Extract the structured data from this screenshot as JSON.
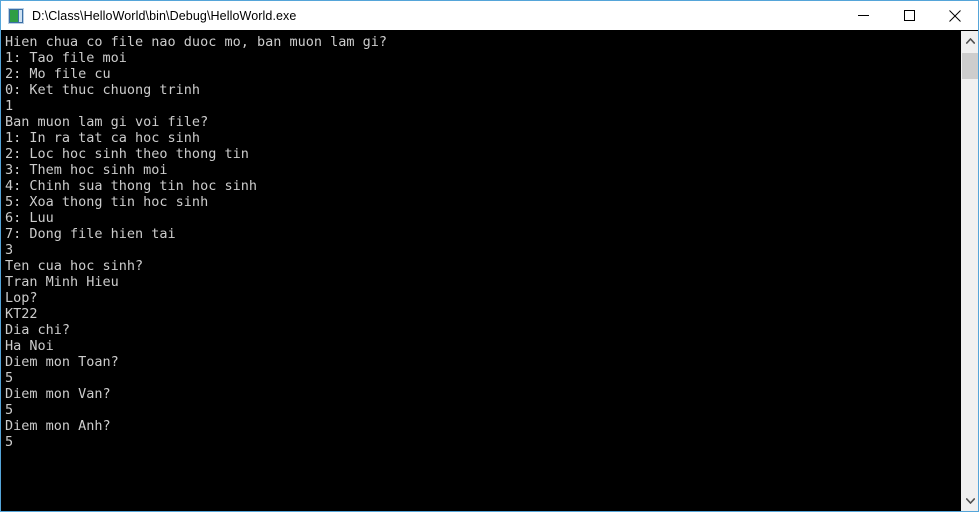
{
  "window": {
    "title": "D:\\Class\\HelloWorld\\bin\\Debug\\HelloWorld.exe",
    "icon": "console-app-icon",
    "controls": {
      "minimize_label": "Minimize",
      "maximize_label": "Maximize",
      "close_label": "Close"
    }
  },
  "console": {
    "background_color": "#000000",
    "text_color": "#cccccc",
    "border_color": "#55a5d9",
    "lines": [
      "Hien chua co file nao duoc mo, ban muon lam gi?",
      "1: Tao file moi",
      "2: Mo file cu",
      "0: Ket thuc chuong trinh",
      "1",
      "Ban muon lam gi voi file?",
      "1: In ra tat ca hoc sinh",
      "2: Loc hoc sinh theo thong tin",
      "3: Them hoc sinh moi",
      "4: Chinh sua thong tin hoc sinh",
      "5: Xoa thong tin hoc sinh",
      "6: Luu",
      "7: Dong file hien tai",
      "3",
      "Ten cua hoc sinh?",
      "Tran Minh Hieu",
      "Lop?",
      "KT22",
      "Dia chi?",
      "Ha Noi",
      "Diem mon Toan?",
      "5",
      "Diem mon Van?",
      "5",
      "Diem mon Anh?",
      "5"
    ]
  },
  "scrollbar": {
    "up_arrow": "chevron-up-icon",
    "down_arrow": "chevron-down-icon",
    "thumb_position_percent": 0,
    "thumb_size_percent": 6
  }
}
